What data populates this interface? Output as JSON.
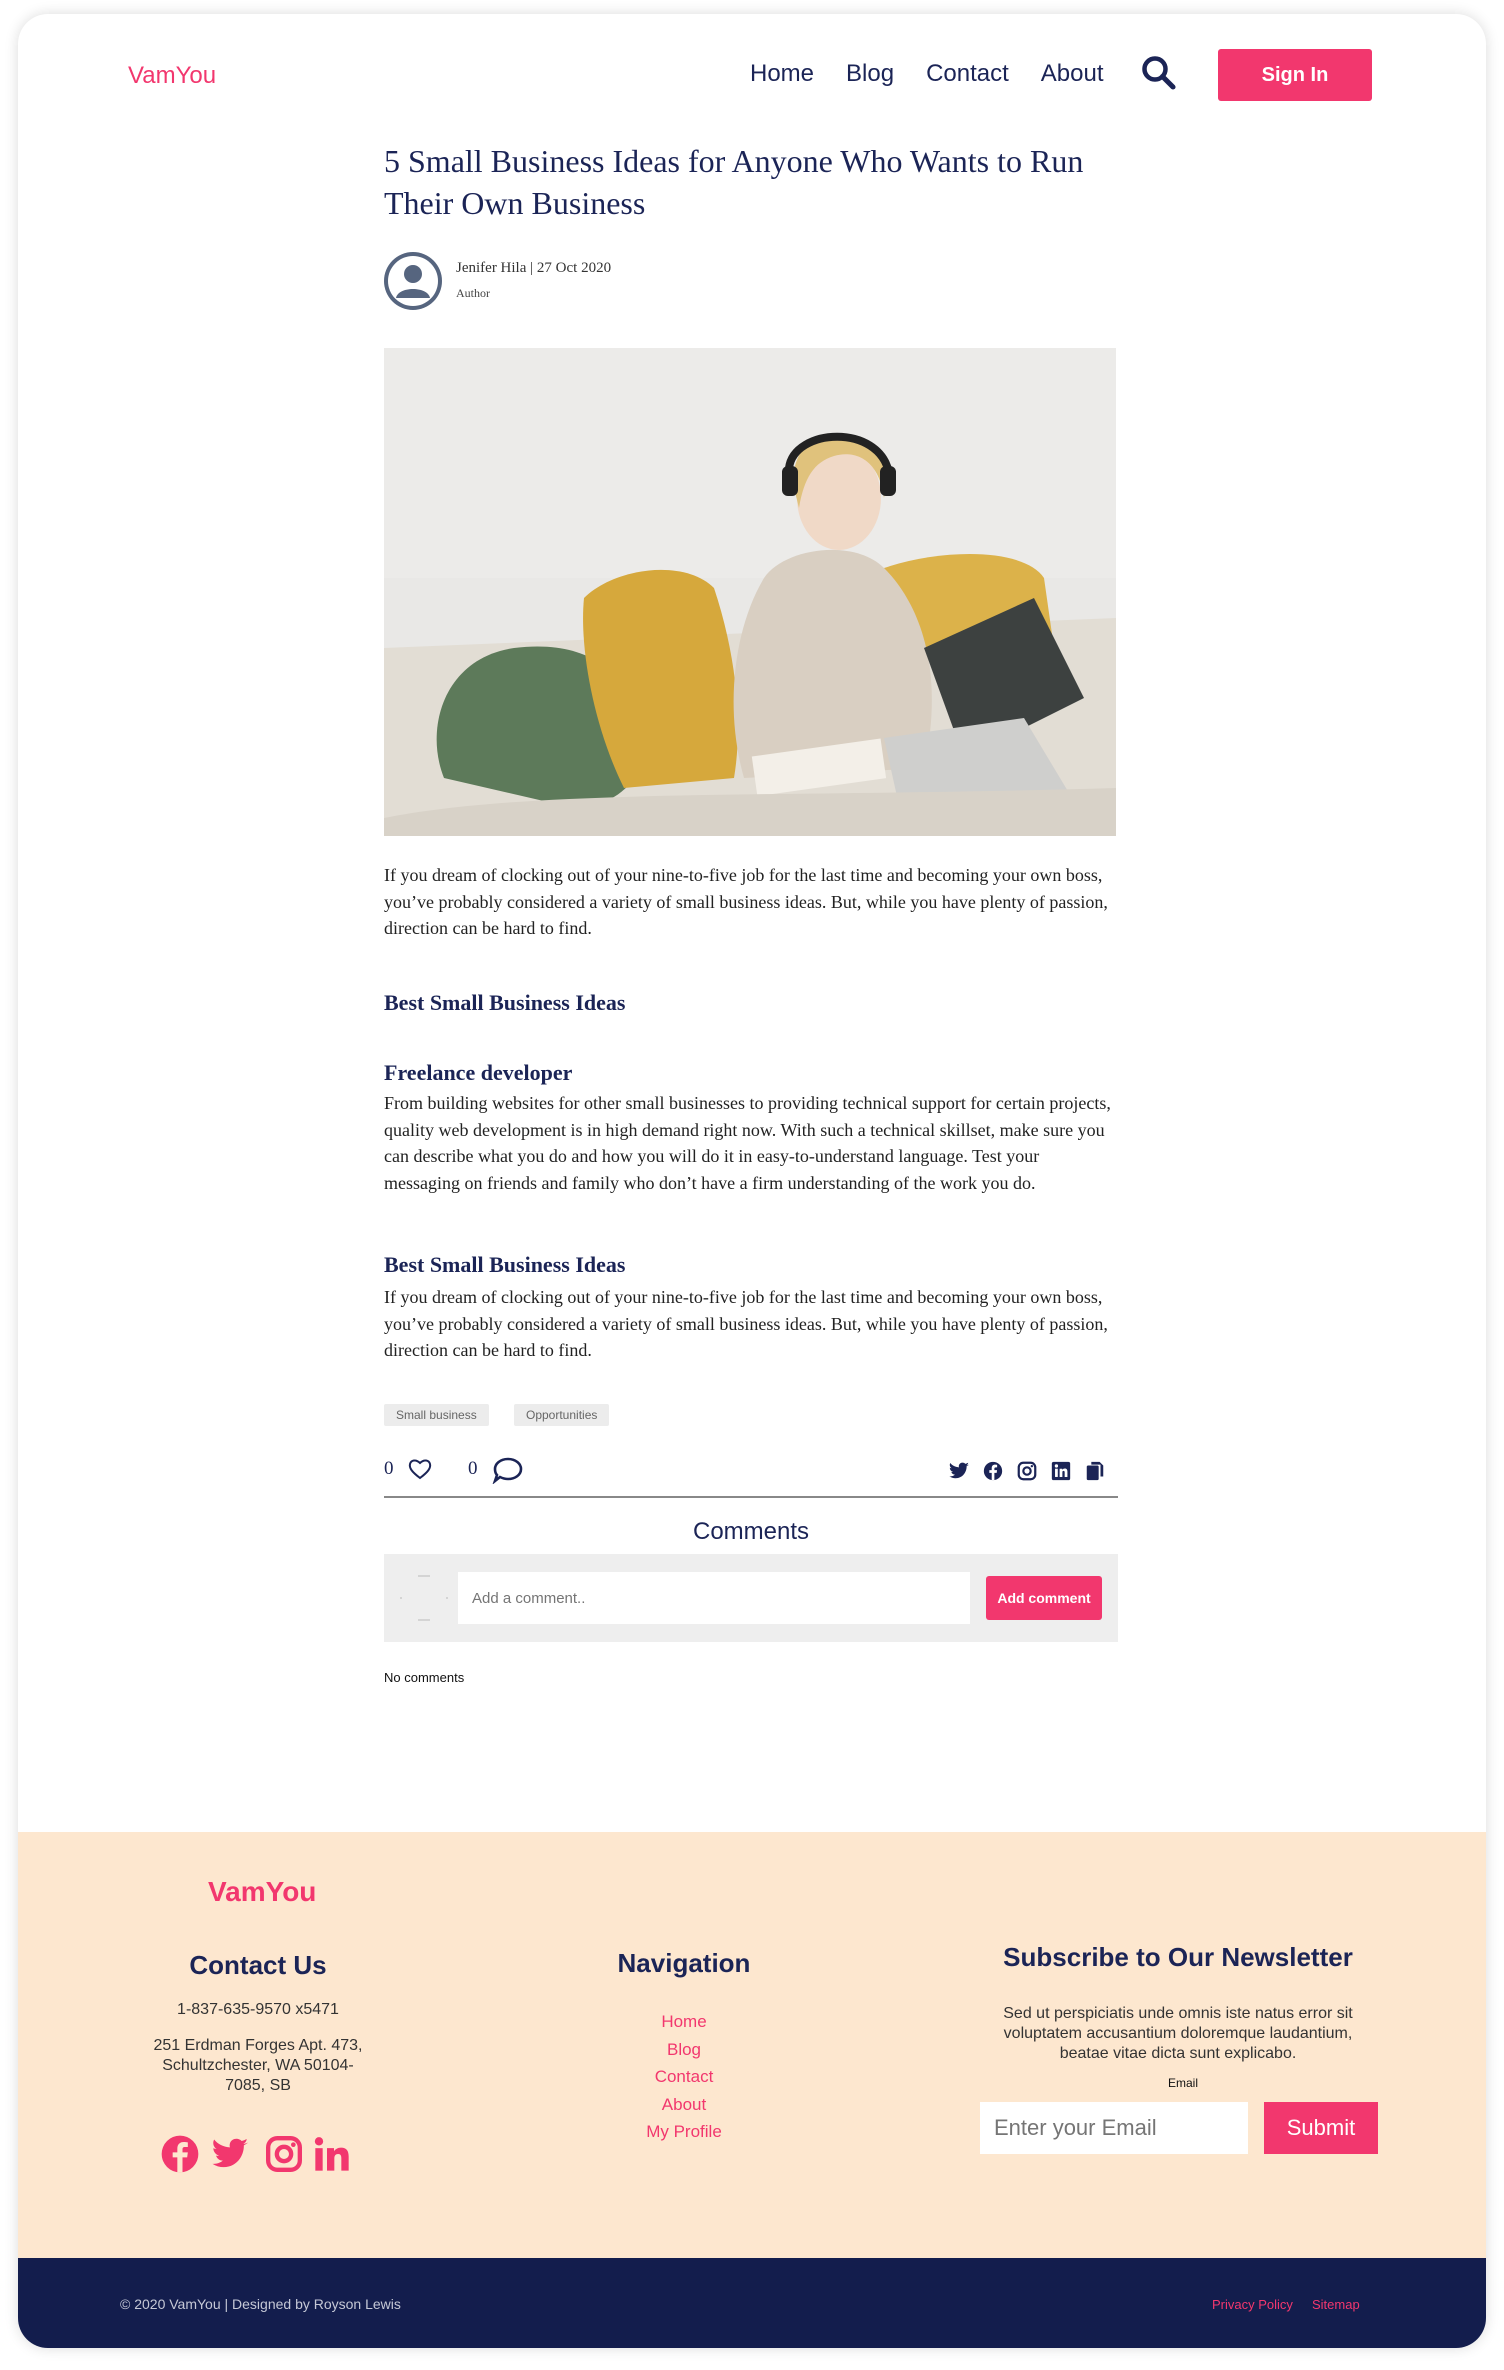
{
  "header": {
    "logo": "VamYou",
    "nav": [
      "Home",
      "Blog",
      "Contact",
      "About"
    ],
    "sign_in": "Sign In"
  },
  "article": {
    "title": "5 Small Business Ideas for Anyone Who Wants to Run Their Own Business",
    "author": "Jenifer Hila",
    "date": "27 Oct 2020",
    "author_role": "Author",
    "intro": "If you dream of clocking out of your nine-to-five job for the last time and becoming your own boss, you’ve probably considered a variety of small business ideas. But, while you have plenty of passion, direction can be hard to find.",
    "section1_title": "Best Small Business Ideas",
    "section2_title": "Freelance developer",
    "section2_body": "From building websites for other small businesses to providing technical support for certain projects, quality web development is in high demand right now. With such a technical skillset, make sure you can describe what you do and how you will do it in easy-to-understand language. Test your messaging on friends and family who don’t have a firm understanding of the work you do.",
    "section3_title": "Best Small Business Ideas",
    "section3_body": "If you dream of clocking out of your nine-to-five job for the last time and becoming your own boss, you’ve probably considered a variety of small business ideas. But, while you have plenty of passion, direction can be hard to find.",
    "tags": [
      "Small business",
      "Opportunities"
    ],
    "likes": "0",
    "comment_count": "0"
  },
  "comments": {
    "title": "Comments",
    "placeholder": "Add a comment..",
    "button": "Add comment",
    "empty": "No comments"
  },
  "footer": {
    "logo": "VamYou",
    "contact_title": "Contact Us",
    "phone": "1-837-635-9570 x5471",
    "address": "251 Erdman Forges Apt. 473, Schultzchester, WA 50104-7085, SB",
    "nav_title": "Navigation",
    "nav_links": [
      "Home",
      "Blog",
      "Contact",
      "About",
      "My Profile"
    ],
    "newsletter_title": "Subscribe to Our Newsletter",
    "newsletter_text": "Sed ut perspiciatis unde omnis iste natus error sit voluptatem accusantium doloremque laudantium, beatae vitae dicta sunt explicabo.",
    "email_label": "Email",
    "email_placeholder": "Enter your Email",
    "submit": "Submit",
    "copyright": "© 2020 VamYou | Designed by Royson Lewis",
    "privacy": "Privacy Policy",
    "sitemap": "Sitemap"
  },
  "colors": {
    "accent": "#f2376e",
    "navy": "#1b2456",
    "footer_bg": "#fde7cf",
    "bottom_bar": "#131d4d"
  }
}
